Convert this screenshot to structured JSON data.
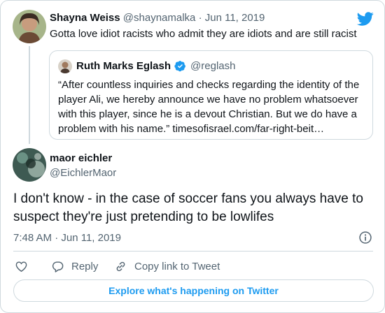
{
  "parent_tweet": {
    "name": "Shayna Weiss",
    "handle": "@shaynamalka",
    "separator": "·",
    "date": "Jun 11, 2019",
    "text": "Gotta love idiot racists who admit they are idiots and are still racist",
    "icons": {
      "brand": "twitter-bird-icon"
    }
  },
  "quoted_tweet": {
    "name": "Ruth Marks Eglash",
    "verified": true,
    "handle": "@reglash",
    "text": "“After countless inquiries and checks regarding the identity of the player Ali, we hereby announce we have no problem whatsoever with this player, since he is a devout Christian. But we do have a problem with his name.” timesofisrael.com/far-right-beit…"
  },
  "main_tweet": {
    "name": "maor eichler",
    "handle": "@EichlerMaor",
    "text": "I don't know - in the case of soccer fans you always have to suspect they're just pretending to be lowlifes",
    "timestamp": "7:48 AM · Jun 11, 2019"
  },
  "actions": {
    "reply_label": "Reply",
    "copy_link_label": "Copy link to Tweet"
  },
  "explore_label": "Explore what's happening on Twitter",
  "colors": {
    "accent": "#1d9bf0",
    "text": "#0f1419",
    "muted": "#536471",
    "border": "#cfd9de"
  }
}
